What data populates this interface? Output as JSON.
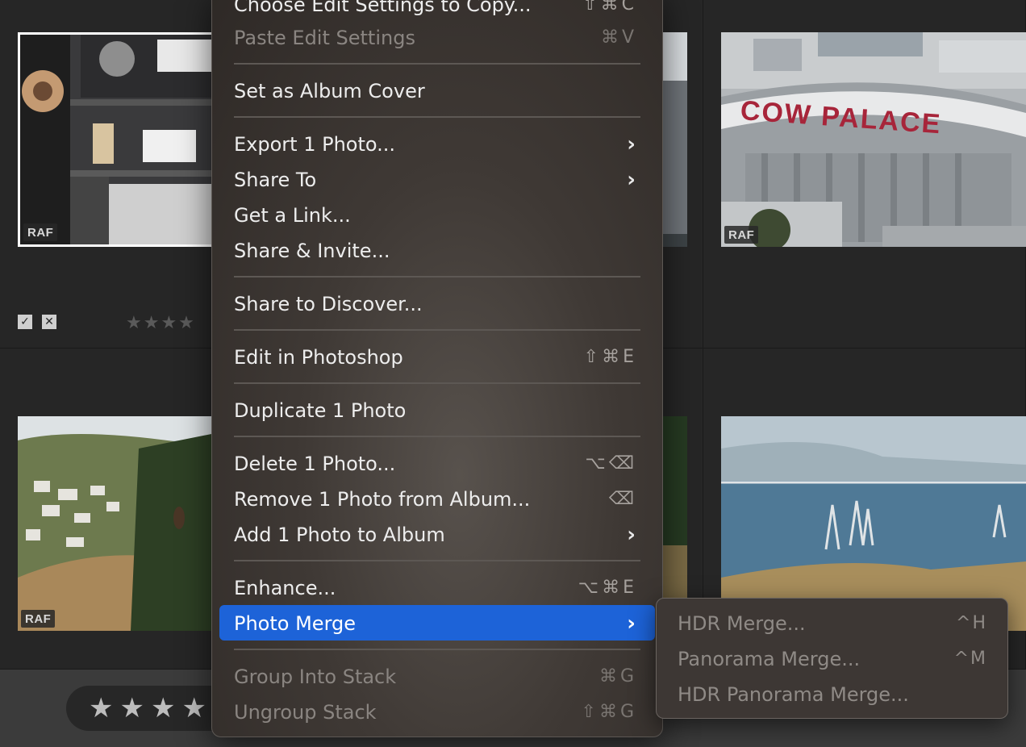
{
  "grid": {
    "badge": "RAF",
    "flag_pick": "✓",
    "flag_reject": "✕",
    "small_stars": "★★★★",
    "photos": [
      {
        "name": "speaker-shelf",
        "badge": "RAF"
      },
      {
        "name": "stadium-left",
        "badge": ""
      },
      {
        "name": "cow-palace",
        "badge": "RAF"
      },
      {
        "name": "hillside-hawk",
        "badge": "RAF"
      },
      {
        "name": "hillside-right",
        "badge": ""
      },
      {
        "name": "bay-pylons",
        "badge": ""
      }
    ],
    "cow_palace_sign": "COW PALACE"
  },
  "bottom_bar": {
    "rating_stars": "★★★★"
  },
  "menu": {
    "items": [
      {
        "label": "Choose Edit Settings to Copy...",
        "shortcut": "⇧⌘C",
        "disabled": false
      },
      {
        "label": "Paste Edit Settings",
        "shortcut": "⌘V",
        "disabled": true
      },
      {
        "label": "Set as Album Cover",
        "shortcut": "",
        "disabled": false
      },
      {
        "label": "Export 1 Photo...",
        "submenu": true
      },
      {
        "label": "Share To",
        "submenu": true
      },
      {
        "label": "Get a Link...",
        "shortcut": ""
      },
      {
        "label": "Share & Invite...",
        "shortcut": ""
      },
      {
        "label": "Share to Discover...",
        "shortcut": ""
      },
      {
        "label": "Edit in Photoshop",
        "shortcut": "⇧⌘E"
      },
      {
        "label": "Duplicate 1 Photo",
        "shortcut": ""
      },
      {
        "label": "Delete 1 Photo...",
        "shortcut": "⌥⌫"
      },
      {
        "label": "Remove 1 Photo from Album...",
        "shortcut": "⌫"
      },
      {
        "label": "Add 1 Photo to Album",
        "submenu": true
      },
      {
        "label": "Enhance...",
        "shortcut": "⌥⌘E"
      },
      {
        "label": "Photo Merge",
        "submenu": true,
        "active": true
      },
      {
        "label": "Group Into Stack",
        "shortcut": "⌘G",
        "disabled": true
      },
      {
        "label": "Ungroup Stack",
        "shortcut": "⇧⌘G",
        "disabled": true
      }
    ],
    "chevron": "›"
  },
  "submenu": {
    "items": [
      {
        "label": "HDR Merge...",
        "shortcut": "^H",
        "disabled": true
      },
      {
        "label": "Panorama Merge...",
        "shortcut": "^M",
        "disabled": true
      },
      {
        "label": "HDR Panorama Merge...",
        "shortcut": "",
        "disabled": true
      }
    ]
  },
  "colors": {
    "highlight": "#1d63d8",
    "menu_bg": "#3f3935",
    "separator": "#5d5854"
  }
}
